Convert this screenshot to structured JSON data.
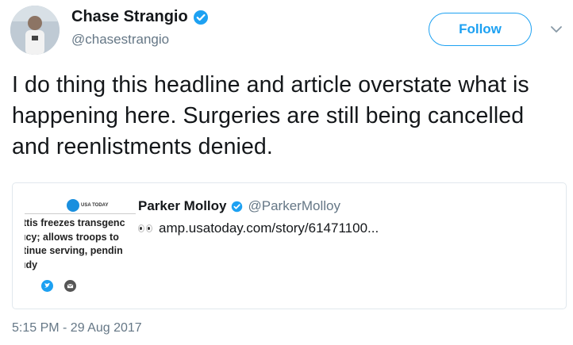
{
  "author": {
    "name": "Chase Strangio",
    "handle": "@chasestrangio"
  },
  "follow_label": "Follow",
  "tweet_text": "I do thing this headline and article overstate what is happening here. Surgeries are still being cancelled and reenlistments denied.",
  "quoted": {
    "name": "Parker Molloy",
    "handle": "@ParkerMolloy",
    "link_text": "amp.usatoday.com/story/61471100...",
    "thumbnail": {
      "logo_text": "USA TODAY",
      "headline": "ttis freezes transgenc\nıcy; allows troops to\ntinue serving, pendin\nıdy"
    }
  },
  "timestamp": "5:15 PM - 29 Aug 2017",
  "colors": {
    "accent": "#1da1f2",
    "text": "#14171a",
    "muted": "#657786",
    "border": "#e1e8ed"
  },
  "icons": [
    "verified-badge-icon",
    "chevron-down-icon",
    "eyes-emoji-icon",
    "twitter-share-icon",
    "email-share-icon"
  ]
}
